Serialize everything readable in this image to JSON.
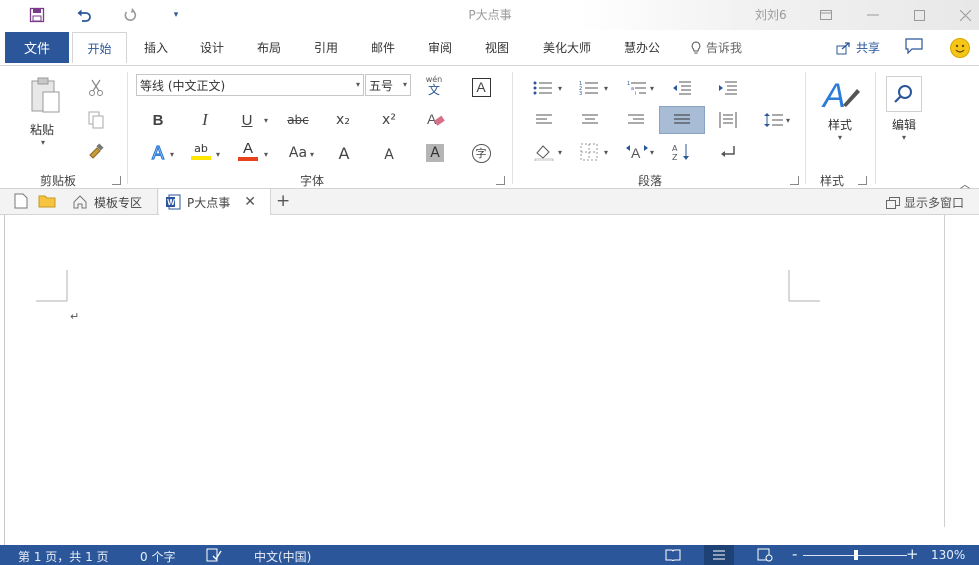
{
  "titlebar": {
    "document_title": "P大点事",
    "user_name": "刘刘6",
    "qat": [
      "save-icon",
      "undo-icon",
      "redo-icon",
      "customize-qat-icon"
    ]
  },
  "tabs": {
    "file": "文件",
    "items": [
      "开始",
      "插入",
      "设计",
      "布局",
      "引用",
      "邮件",
      "审阅",
      "视图",
      "美化大师",
      "慧办公"
    ],
    "active": "开始",
    "tell_me": "告诉我",
    "share": "共享"
  },
  "ribbon": {
    "clipboard": {
      "paste_label": "粘贴",
      "group_label": "剪贴板"
    },
    "font": {
      "font_name": "等线 (中文正文)",
      "font_size": "五号",
      "phonetic_top": "wén",
      "phonetic_bottom": "文",
      "group_label": "字体",
      "bold": "B",
      "italic": "I",
      "underline": "U",
      "strikethrough": "abc",
      "subscript": "x₂",
      "superscript": "x²",
      "change_case": "Aa",
      "grow_font": "A",
      "shrink_font": "A",
      "shade": "A",
      "enclose": "字",
      "border_a": "A",
      "font_color_letter": "A",
      "highlight_letters": "ab",
      "highlight_color": "#ffe600",
      "font_color": "#e8421a",
      "text_effects_letter": "A"
    },
    "paragraph": {
      "group_label": "段落"
    },
    "styles": {
      "label": "样式",
      "group_label": "样式"
    },
    "editing": {
      "label": "编辑"
    }
  },
  "doc_tabs": {
    "templates": "模板专区",
    "document": "P大点事",
    "multi_window": "显示多窗口"
  },
  "document": {
    "paragraph_mark": "↵"
  },
  "status": {
    "page": "第 1 页，共 1 页",
    "words": "0 个字",
    "language": "中文(中国)",
    "zoom": "130%",
    "zoom_minus": "-",
    "zoom_plus": "+"
  },
  "colors": {
    "accent": "#2b579a"
  }
}
